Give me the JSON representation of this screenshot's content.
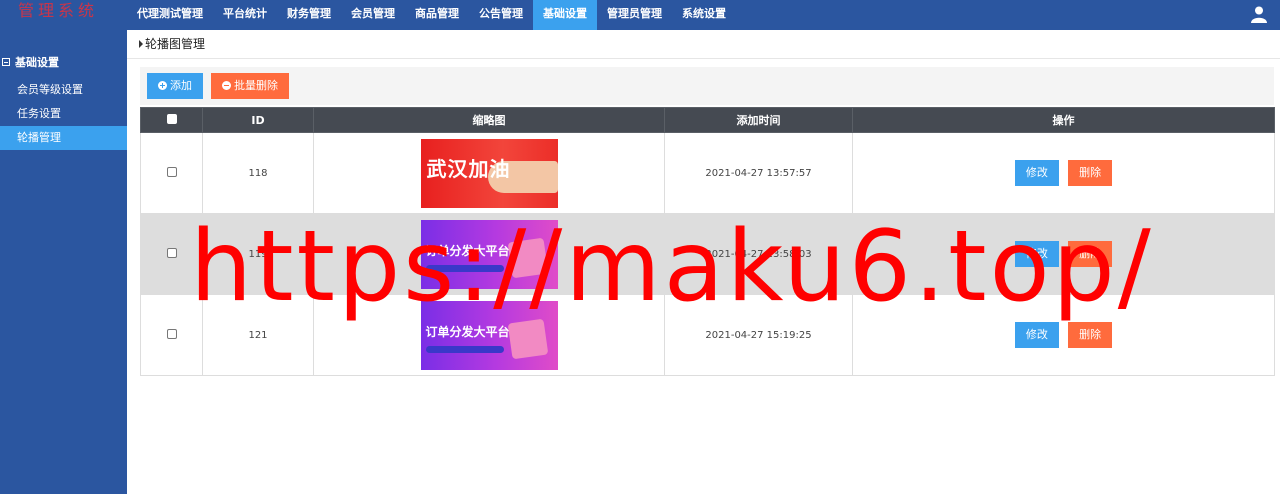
{
  "app": {
    "logo": "管理系统"
  },
  "topnav": {
    "items": [
      {
        "label": "代理测试管理"
      },
      {
        "label": "平台统计"
      },
      {
        "label": "财务管理"
      },
      {
        "label": "会员管理"
      },
      {
        "label": "商品管理"
      },
      {
        "label": "公告管理"
      },
      {
        "label": "基础设置",
        "active": true
      },
      {
        "label": "管理员管理"
      },
      {
        "label": "系统设置"
      }
    ],
    "user_icon": "user-icon"
  },
  "sidebar": {
    "group": "基础设置",
    "items": [
      {
        "label": "会员等级设置"
      },
      {
        "label": "任务设置"
      },
      {
        "label": "轮播管理",
        "active": true
      }
    ]
  },
  "breadcrumb": {
    "title": "轮播图管理"
  },
  "toolbar": {
    "add_label": "添加",
    "bulk_delete_label": "批量删除"
  },
  "table": {
    "columns": {
      "id": "ID",
      "thumb": "缩略图",
      "time": "添加时间",
      "ops": "操作"
    },
    "rows": [
      {
        "id": "118",
        "time": "2021-04-27 13:57:57",
        "thumb_style": "red",
        "thumb_text": "武汉加油"
      },
      {
        "id": "119",
        "time": "2021-04-27 13:58:03",
        "thumb_style": "purple",
        "thumb_text": "订单分发大平台"
      },
      {
        "id": "121",
        "time": "2021-04-27 15:19:25",
        "thumb_style": "purple",
        "thumb_text": "订单分发大平台"
      }
    ],
    "edit_label": "修改",
    "delete_label": "删除"
  },
  "watermark": "https://maku6.top/",
  "colors": {
    "nav_bg": "#2b56a0",
    "active": "#3ba1ee",
    "danger": "#ff6b3d",
    "table_head": "#454a52"
  }
}
